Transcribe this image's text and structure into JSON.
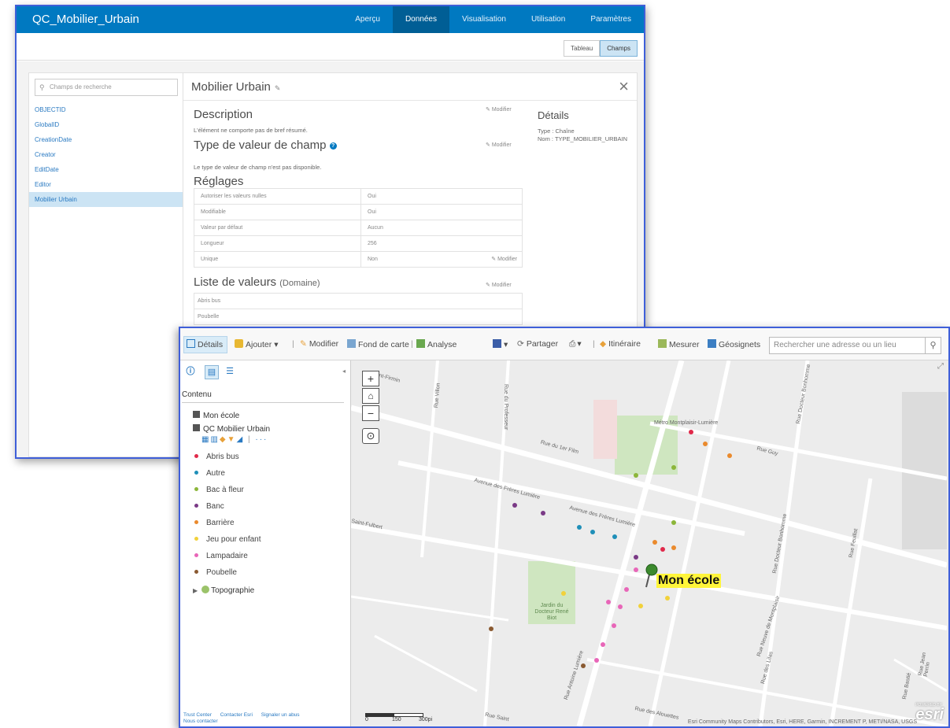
{
  "win1": {
    "app_title": "QC_Mobilier_Urbain",
    "nav": [
      "Aperçu",
      "Données",
      "Visualisation",
      "Utilisation",
      "Paramètres"
    ],
    "nav_active": "Données",
    "view_toggle": [
      "Tableau",
      "Champs"
    ],
    "view_active": "Champs",
    "field_search_placeholder": "Champs de recherche",
    "fields": [
      "OBJECTID",
      "GlobalID",
      "CreationDate",
      "Creator",
      "EditDate",
      "Editor",
      "Mobilier Urbain"
    ],
    "field_selected": "Mobilier Urbain",
    "detail": {
      "title": "Mobilier Urbain",
      "description_heading": "Description",
      "description_text": "L'élément ne comporte pas de bref résumé.",
      "modifier_label": "Modifier",
      "value_type_heading": "Type de valeur de champ",
      "value_type_text": "Le type de valeur de champ n'est pas disponible.",
      "settings_heading": "Réglages",
      "settings": [
        [
          "Autoriser les valeurs nulles",
          "Oui"
        ],
        [
          "Modifiable",
          "Oui"
        ],
        [
          "Valeur par défaut",
          "Aucun"
        ],
        [
          "Longueur",
          "256"
        ],
        [
          "Unique",
          "Non"
        ]
      ],
      "domain_heading": "Liste de valeurs",
      "domain_sub": "(Domaine)",
      "domain_values": [
        "Abris bus",
        "Poubelle"
      ],
      "details_heading": "Détails",
      "details_type": "Type : Chaîne",
      "details_name": "Nom : TYPE_MOBILIER_URBAIN"
    }
  },
  "win2": {
    "toolbar": {
      "details": "Détails",
      "ajouter": "Ajouter",
      "modifier": "Modifier",
      "fond": "Fond de carte",
      "analyse": "Analyse",
      "partager": "Partager",
      "itineraire": "Itinéraire",
      "mesurer": "Mesurer",
      "geosignets": "Géosignets",
      "search_placeholder": "Rechercher une adresse ou un lieu"
    },
    "panel": {
      "contenu": "Contenu",
      "layer1": "Mon école",
      "layer2": "QC Mobilier Urbain",
      "legend": [
        {
          "label": "Abris bus",
          "color": "#e0294a"
        },
        {
          "label": "Autre",
          "color": "#1f8fb8"
        },
        {
          "label": "Bac à fleur",
          "color": "#8cb63a"
        },
        {
          "label": "Banc",
          "color": "#7a3a86"
        },
        {
          "label": "Barrière",
          "color": "#ea8a2d"
        },
        {
          "label": "Jeu pour enfant",
          "color": "#f1d13b"
        },
        {
          "label": "Lampadaire",
          "color": "#e866b8"
        },
        {
          "label": "Poubelle",
          "color": "#8a5a32"
        }
      ],
      "layer3": "Topographie",
      "footer": [
        "Trust Center",
        "Contacter Esri",
        "Signaler un abus",
        "Nous contacter"
      ]
    },
    "map": {
      "school_label": "Mon école",
      "streets": [
        "Saint-Firmin",
        "Rue du Professeur",
        "Rue Villon",
        "Rue du 1er Film",
        "Avenue des Frères Lumière",
        "Avenue des Frères Lumière",
        "Rue Guy",
        "Rue Docteur Bonhomme",
        "Rue Docteur Bonhomme",
        "Saint-Fulbert",
        "Rue Feuillat",
        "Rue des Lilas",
        "Rue Neuve de Montplaisir",
        "Rue Antoine Lumière",
        "Rue des Alouettes",
        "Rue Jean Perrin",
        "Rue Bastié",
        "Rue Saint",
        "Jardin du Docteur René Biot",
        "Métro Montplaisir-Lumière"
      ],
      "scale_labels": [
        "0",
        "150",
        "300pi"
      ],
      "credit": "Esri Community Maps Contributors, Esri, HERE, Garmin, INCREMENT P, METI/NASA, USGS",
      "esri": "esri",
      "powered": "POWERED BY"
    }
  }
}
